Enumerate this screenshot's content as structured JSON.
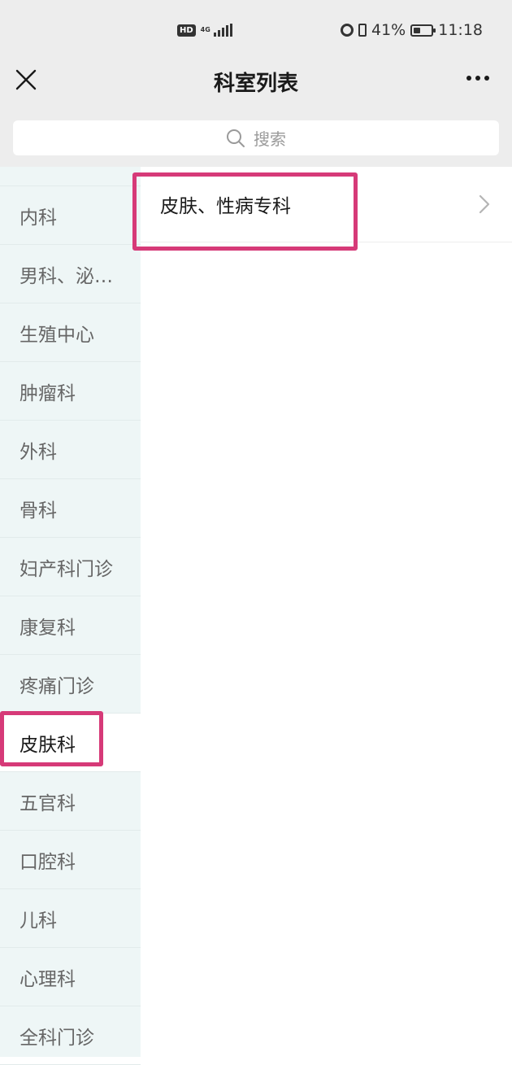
{
  "status_bar": {
    "hd": "HD",
    "network": "4G",
    "battery_percent": "41%",
    "battery_level": 0.41,
    "time": "11:18"
  },
  "nav": {
    "title": "科室列表",
    "close_icon": "close-icon",
    "more_icon": "more-icon"
  },
  "search": {
    "placeholder": "搜索",
    "icon": "search-icon"
  },
  "sidebar": {
    "items": [
      {
        "label": "内科"
      },
      {
        "label": "男科、泌尿外科"
      },
      {
        "label": "生殖中心"
      },
      {
        "label": "肿瘤科"
      },
      {
        "label": "外科"
      },
      {
        "label": "骨科"
      },
      {
        "label": "妇产科门诊"
      },
      {
        "label": "康复科"
      },
      {
        "label": "疼痛门诊"
      },
      {
        "label": "皮肤科"
      },
      {
        "label": "五官科"
      },
      {
        "label": "口腔科"
      },
      {
        "label": "儿科"
      },
      {
        "label": "心理科"
      },
      {
        "label": "全科门诊"
      }
    ],
    "active_index": 9
  },
  "content": {
    "rows": [
      {
        "label": "皮肤、性病专科",
        "icon": "chevron-right-icon"
      }
    ]
  },
  "colors": {
    "header_bg": "#ededed",
    "sidebar_bg": "#eef6f6",
    "highlight": "#d63a78"
  }
}
